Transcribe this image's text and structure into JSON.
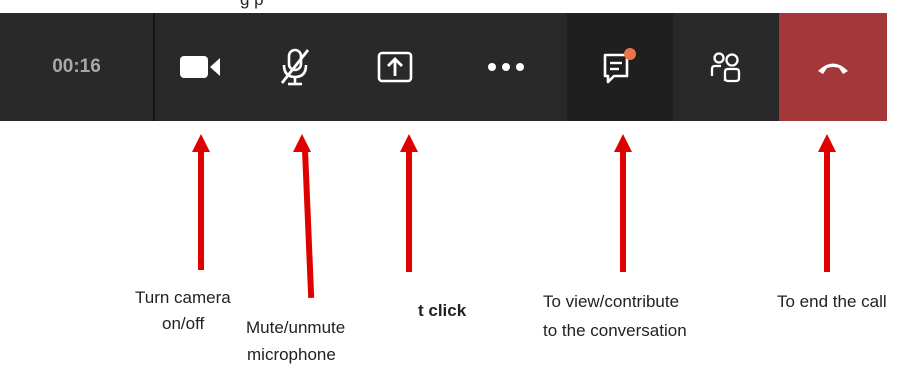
{
  "header_fragment": "g                 p",
  "toolbar": {
    "timer": "00:16",
    "buttons": [
      {
        "name": "camera",
        "icon": "video-camera-icon"
      },
      {
        "name": "microphone",
        "icon": "microphone-muted-icon"
      },
      {
        "name": "share",
        "icon": "share-screen-icon"
      },
      {
        "name": "more",
        "icon": "more-options-icon"
      },
      {
        "name": "chat",
        "icon": "chat-icon",
        "badge_color": "#e97548"
      },
      {
        "name": "participants",
        "icon": "participants-icon"
      },
      {
        "name": "hangup",
        "icon": "hang-up-icon",
        "color": "#a4373a"
      }
    ]
  },
  "annotations": {
    "camera_line1": "Turn camera",
    "camera_line2": "on/off",
    "mic_line1": "Mute/unmute",
    "mic_line2": "microphone",
    "share_label": "t click",
    "chat_line1": "To view/contribute",
    "chat_line2": "to the conversation",
    "hangup_label": "To end the call"
  },
  "colors": {
    "toolbar_bg": "#292929",
    "chat_bg": "#1f1f1f",
    "hangup_bg": "#a4373a",
    "arrow": "#e00000"
  }
}
